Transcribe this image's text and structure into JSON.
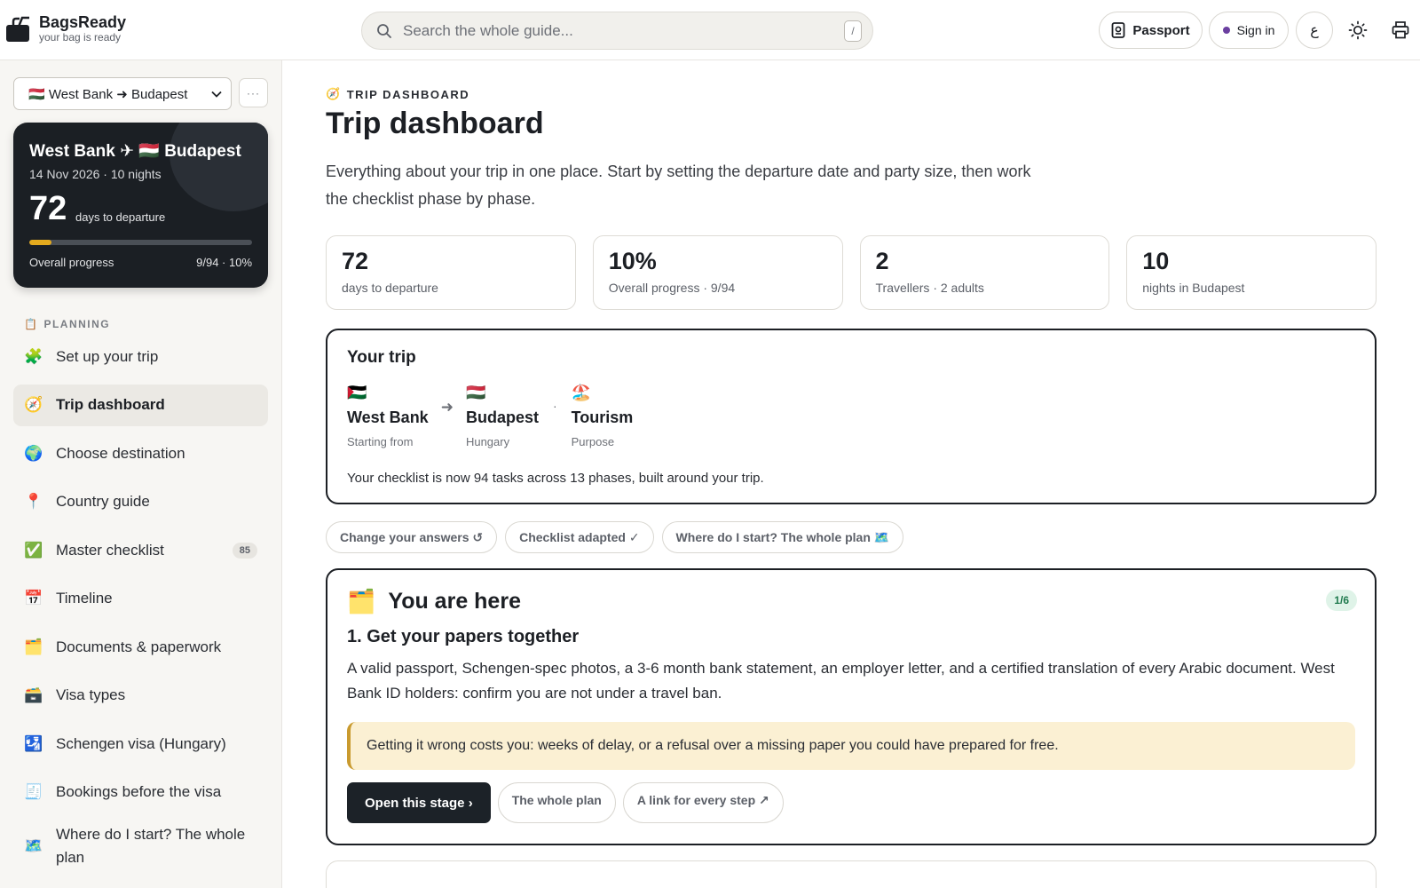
{
  "header": {
    "brand_name": "BagsReady",
    "brand_tagline": "your bag is ready",
    "search_placeholder": "Search the whole guide...",
    "search_shortcut": "/",
    "passport_label": "Passport",
    "signin_label": "Sign in",
    "language_label": "ع"
  },
  "sidebar": {
    "trip_select_value": "🇭🇺 West Bank ➜ Budapest",
    "more_label": "···",
    "trip_card": {
      "title": "West Bank ✈ 🇭🇺 Budapest",
      "subtitle": "14 Nov 2026 · 10 nights",
      "days": "72",
      "days_label": "days to departure",
      "progress_fraction": 0.1,
      "progress_label": "Overall progress",
      "progress_value": "9/94 · 10%"
    },
    "section_label": "PLANNING",
    "section_icon": "📋",
    "items": [
      {
        "icon": "🧩",
        "label": "Set up your trip"
      },
      {
        "icon": "🧭",
        "label": "Trip dashboard"
      },
      {
        "icon": "🌍",
        "label": "Choose destination"
      },
      {
        "icon": "📍",
        "label": "Country guide"
      },
      {
        "icon": "✅",
        "label": "Master checklist",
        "badge": "85"
      },
      {
        "icon": "📅",
        "label": "Timeline"
      },
      {
        "icon": "🗂️",
        "label": "Documents & paperwork"
      },
      {
        "icon": "🗃️",
        "label": "Visa types"
      },
      {
        "icon": "🛂",
        "label": "Schengen visa (Hungary)"
      },
      {
        "icon": "🧾",
        "label": "Bookings before the visa"
      },
      {
        "icon": "🗺️",
        "label": "Where do I start? The whole plan"
      }
    ]
  },
  "main": {
    "eyebrow_icon": "🧭",
    "eyebrow": "TRIP DASHBOARD",
    "title": "Trip dashboard",
    "intro": "Everything about your trip in one place. Start by setting the departure date and party size, then work the checklist phase by phase.",
    "stats": [
      {
        "value": "72",
        "label": "days to departure"
      },
      {
        "value": "10%",
        "label": "Overall progress · 9/94"
      },
      {
        "value": "2",
        "label": "Travellers · 2 adults"
      },
      {
        "value": "10",
        "label": "nights in Budapest"
      }
    ],
    "trip": {
      "title": "Your trip",
      "origin_flag": "🇵🇸",
      "origin": "West Bank",
      "origin_sub": "Starting from",
      "arrow": "➜",
      "dest_flag": "🇭🇺",
      "destination": "Budapest",
      "dest_sub": "Hungary",
      "dot": "·",
      "purpose_icon": "🏖️",
      "purpose": "Tourism",
      "purpose_sub": "Purpose",
      "note": "Your checklist is now 94 tasks across 13 phases, built around your trip."
    },
    "chips": [
      "Change your answers ↺",
      "Checklist adapted ✓",
      "Where do I start? The whole plan 🗺️"
    ],
    "here": {
      "icon": "🗂️",
      "title": "You are here",
      "step": "1/6",
      "stage_title": "1. Get your papers together",
      "stage_desc": "A valid passport, Schengen-spec photos, a 3-6 month bank statement, an employer letter, and a certified translation of every Arabic document. West Bank ID holders: confirm you are not under a travel ban.",
      "warning": "Getting it wrong costs you: weeks of delay, or a refusal over a missing paper you could have prepared for free.",
      "primary_action": "Open this stage ›",
      "secondary_action": "The whole plan",
      "tertiary_action": "A link for every step ↗"
    }
  }
}
